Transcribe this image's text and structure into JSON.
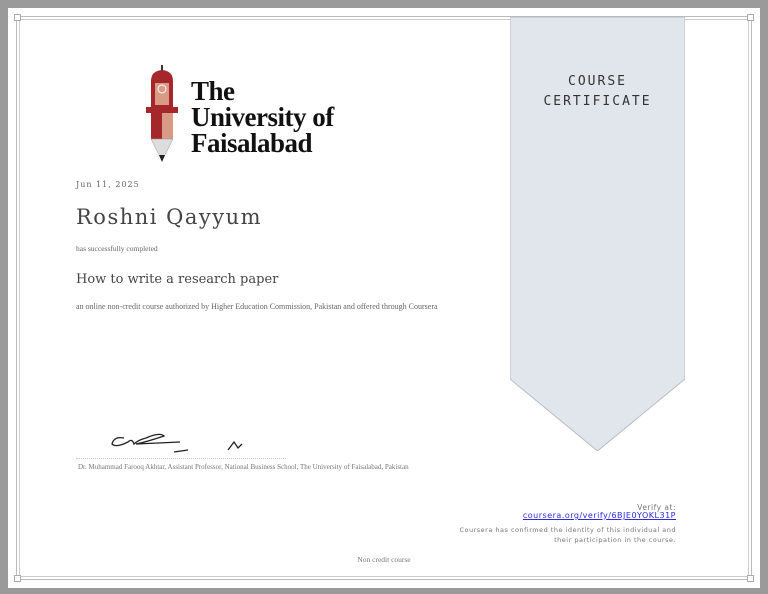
{
  "institution": {
    "logo_lines": [
      "The",
      "University of",
      "Faisalabad"
    ]
  },
  "ribbon": {
    "line1": "COURSE",
    "line2": "CERTIFICATE",
    "color": "#e1e5ec"
  },
  "certificate": {
    "date": "Jun 11, 2025",
    "recipient": "Roshni Qayyum",
    "completed_text": "has successfully completed",
    "course_title": "How to write a research paper",
    "description": "an online non-credit course authorized by Higher Education Commission, Pakistan and offered through Coursera",
    "signer": "Dr. Muhammad Farooq Akhtar, Assistant Professor, National Business School, The University of Faisalabad, Pakistan",
    "footer": "Non credit course"
  },
  "verification": {
    "label": "Verify at:",
    "link": "coursera.org/verify/6BJE0YOKL31P",
    "line1": "Coursera has confirmed the identity of this individual and",
    "line2": "their participation in the course."
  }
}
